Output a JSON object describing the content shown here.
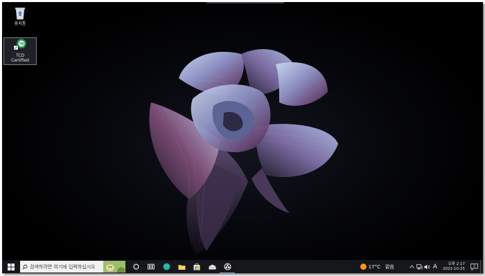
{
  "desktop": {
    "icons": [
      {
        "name": "recycle-bin",
        "label": "휴지통",
        "icon": "recycle-bin-icon"
      },
      {
        "name": "tcd-certified",
        "label": "TCD\nCertified",
        "icon": "tcd-app-icon"
      }
    ],
    "wallpaper": "abstract-fabric-flower"
  },
  "taskbar": {
    "start_icon": "windows-logo-icon",
    "search": {
      "placeholder": "검색하려면 여기에 입력하십시오",
      "icon": "search-icon"
    },
    "apps": [
      {
        "name": "cortana",
        "icon": "circle-icon"
      },
      {
        "name": "task-view",
        "icon": "task-view-icon"
      },
      {
        "name": "edge",
        "icon": "edge-icon"
      },
      {
        "name": "file-explorer",
        "icon": "folder-icon"
      },
      {
        "name": "store",
        "icon": "store-icon"
      },
      {
        "name": "mail",
        "icon": "mail-icon"
      },
      {
        "name": "obs",
        "icon": "obs-icon"
      }
    ],
    "tray": {
      "weather_temp": "17°C",
      "weather_desc": "맑음",
      "ime": "A",
      "time": "오후 2:17",
      "date": "2022-10-25",
      "notification_count": "2"
    }
  },
  "colors": {
    "taskbar_bg": "#15171a",
    "accent": "#7fb2e8",
    "sun": "#f7941d"
  }
}
